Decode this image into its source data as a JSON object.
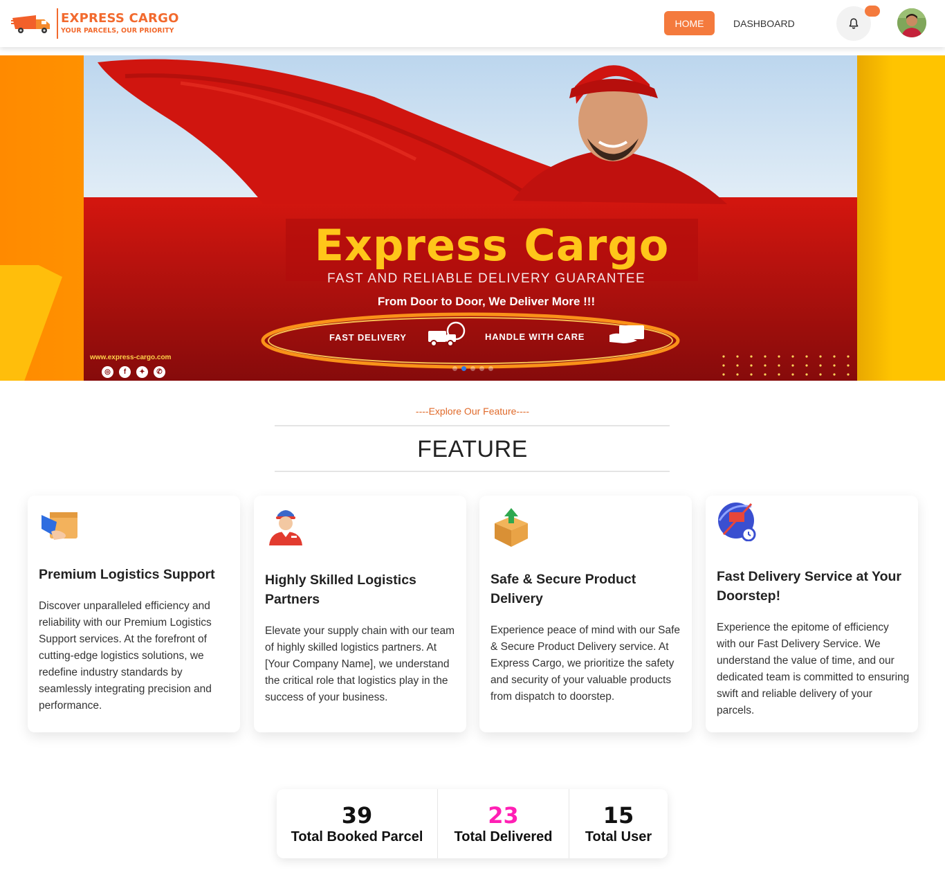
{
  "nav": {
    "brand_title": "EXPRESS CARGO",
    "brand_tagline": "YOUR PARCELS, OUR PRIORITY",
    "home_label": "HOME",
    "dashboard_label": "DASHBOARD",
    "notification_icon": "bell-icon",
    "accent_color": "#f47a3d"
  },
  "hero": {
    "title": "Express Cargo",
    "subtitle": "FAST AND RELIABLE DELIVERY GUARANTEE",
    "tagline": "From Door to Door, We Deliver More !!!",
    "badge_left": "FAST DELIVERY",
    "badge_right": "HANDLE WITH CARE",
    "website": "www.express-cargo.com",
    "socials": [
      "instagram-icon",
      "facebook-icon",
      "twitter-icon",
      "whatsapp-icon"
    ],
    "slide_count": 5,
    "active_slide": 2
  },
  "features": {
    "eyebrow": "----Explore Our Feature----",
    "heading": "FEATURE",
    "cards": [
      {
        "icon": "logistics-box-icon",
        "title": "Premium Logistics Support",
        "description": "Discover unparalleled efficiency and reliability with our Premium Logistics Support services. At the forefront of cutting-edge logistics solutions, we redefine industry standards by seamlessly integrating precision and performance."
      },
      {
        "icon": "delivery-person-icon",
        "title": "Highly Skilled Logistics Partners",
        "description": "Elevate your supply chain with our team of highly skilled logistics partners. At [Your Company Name], we understand the critical role that logistics play in the success of your business."
      },
      {
        "icon": "package-box-icon",
        "title": "Safe & Secure Product Delivery",
        "description": "Experience peace of mind with our Safe & Secure Product Delivery service. At Express Cargo, we prioritize the safety and security of your valuable products from dispatch to doorstep."
      },
      {
        "icon": "fast-delivery-icon",
        "title": "Fast Delivery Service at Your Doorstep!",
        "description": "Experience the epitome of efficiency with our Fast Delivery Service. We understand the value of time, and our dedicated team is committed to ensuring swift and reliable delivery of your parcels."
      }
    ]
  },
  "stats": [
    {
      "value": "39",
      "label": "Total Booked Parcel",
      "color": "#111111"
    },
    {
      "value": "23",
      "label": "Total Delivered",
      "color": "#ff1fb4"
    },
    {
      "value": "15",
      "label": "Total User",
      "color": "#111111"
    }
  ]
}
